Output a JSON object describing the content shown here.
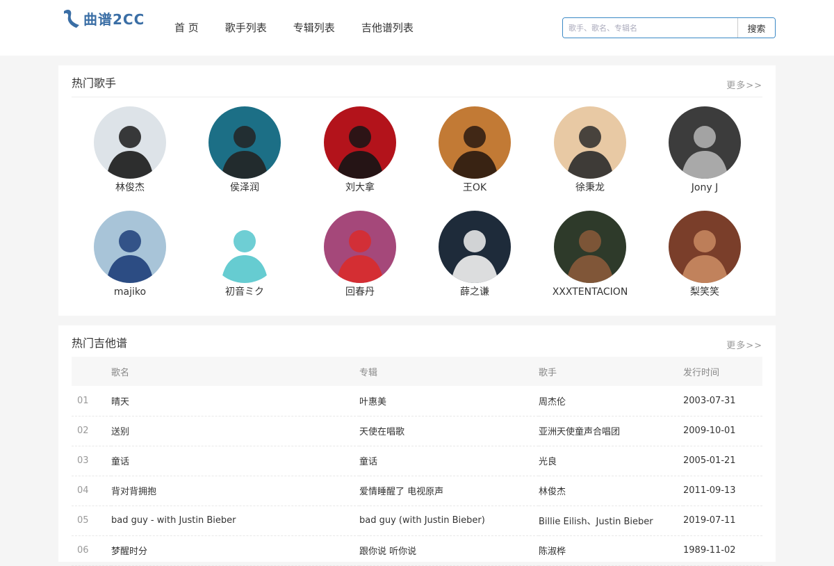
{
  "header": {
    "logo_text": "曲谱2CC",
    "nav": [
      "首 页",
      "歌手列表",
      "专辑列表",
      "吉他谱列表"
    ],
    "search_placeholder": "歌手、歌名、专辑名",
    "search_button": "搜索"
  },
  "hot_singers": {
    "title": "热门歌手",
    "more": "更多>>",
    "items": [
      {
        "name": "林俊杰",
        "bg": "#dde3e8",
        "fg": "#1a1a1a"
      },
      {
        "name": "侯泽润",
        "bg": "#1c6f86",
        "fg": "#232323"
      },
      {
        "name": "刘大拿",
        "bg": "#b3131b",
        "fg": "#151515"
      },
      {
        "name": "王OK",
        "bg": "#c27a35",
        "fg": "#2a1a10"
      },
      {
        "name": "徐秉龙",
        "bg": "#e8c9a4",
        "fg": "#2b2b2b"
      },
      {
        "name": "Jony J",
        "bg": "#3c3c3c",
        "fg": "#b5b5b5"
      },
      {
        "name": "majiko",
        "bg": "#a8c4d8",
        "fg": "#1e3f7a"
      },
      {
        "name": "初音ミク",
        "bg": "#ffffff",
        "fg": "#55c6cc"
      },
      {
        "name": "回春丹",
        "bg": "#a5487a",
        "fg": "#d92b2b"
      },
      {
        "name": "薛之谦",
        "bg": "#1e2b3a",
        "fg": "#f1f1f1"
      },
      {
        "name": "XXXTENTACION",
        "bg": "#2e3a2a",
        "fg": "#8a5a3a"
      },
      {
        "name": "梨笑笑",
        "bg": "#7a3e2a",
        "fg": "#c98a62"
      }
    ]
  },
  "hot_tabs": {
    "title": "热门吉他谱",
    "more": "更多>>",
    "columns": [
      "",
      "歌名",
      "专辑",
      "歌手",
      "发行时间"
    ],
    "rows": [
      {
        "num": "01",
        "song": "晴天",
        "album": "叶惠美",
        "artist": "周杰伦",
        "date": "2003-07-31"
      },
      {
        "num": "02",
        "song": "送别",
        "album": "天使在唱歌",
        "artist": "亚洲天使童声合唱团",
        "date": "2009-10-01"
      },
      {
        "num": "03",
        "song": "童话",
        "album": "童话",
        "artist": "光良",
        "date": "2005-01-21"
      },
      {
        "num": "04",
        "song": "背对背拥抱",
        "album": "爱情睡醒了 电视原声",
        "artist": "林俊杰",
        "date": "2011-09-13"
      },
      {
        "num": "05",
        "song": "bad guy - with Justin Bieber",
        "album": "bad guy (with Justin Bieber)",
        "artist": "Billie Eilish、Justin Bieber",
        "date": "2019-07-11"
      },
      {
        "num": "06",
        "song": "梦醒时分",
        "album": "跟你说 听你说",
        "artist": "陈淑桦",
        "date": "1989-11-02"
      }
    ]
  },
  "colors": {
    "accent": "#3a88c5",
    "logo": "#3a6ea5"
  }
}
